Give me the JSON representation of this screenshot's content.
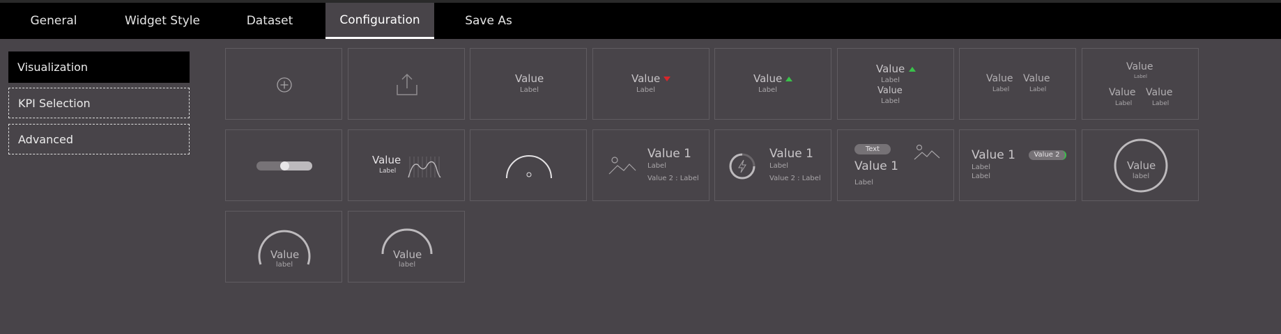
{
  "tabs": [
    {
      "label": "General"
    },
    {
      "label": "Widget Style"
    },
    {
      "label": "Dataset"
    },
    {
      "label": "Configuration"
    },
    {
      "label": "Save As"
    }
  ],
  "sidebar": {
    "items": [
      {
        "label": "Visualization"
      },
      {
        "label": "KPI Selection"
      },
      {
        "label": "Advanced"
      }
    ]
  },
  "widgets": {
    "value_label": {
      "value": "Value",
      "label": "Label"
    },
    "value_down": {
      "value": "Value",
      "label": "Label"
    },
    "value_up": {
      "value": "Value",
      "label": "Label"
    },
    "value_stack": {
      "value1": "Value",
      "label1": "Label",
      "value2": "Value",
      "label2": "Label"
    },
    "two_values": {
      "value1": "Value",
      "label1": "Label",
      "value2": "Value",
      "label2": "Label"
    },
    "three_values": {
      "value1": "Value",
      "label1": "Label",
      "value2": "Value",
      "label2": "Label",
      "value3": "Value",
      "label3": "Label"
    },
    "sparkline": {
      "value": "Value",
      "label": "Label"
    },
    "image_values": {
      "value1": "Value 1",
      "label": "Label",
      "value2": "Value 2 : Label"
    },
    "progress_values": {
      "value1": "Value 1",
      "label": "Label",
      "value2": "Value 2 : Label"
    },
    "text_badge": {
      "badge": "Text",
      "value": "Value 1",
      "label": "Label"
    },
    "pill_values": {
      "value1": "Value 1",
      "label1": "Label",
      "label2": "Label",
      "pill": "Value 2"
    },
    "circle": {
      "value": "Value",
      "label": "label"
    },
    "gauge_1": {
      "value": "Value",
      "label": "label"
    },
    "gauge_2": {
      "value": "Value",
      "label": "label"
    }
  },
  "colors": {
    "up": "#39c24a",
    "down": "#d8262a"
  }
}
